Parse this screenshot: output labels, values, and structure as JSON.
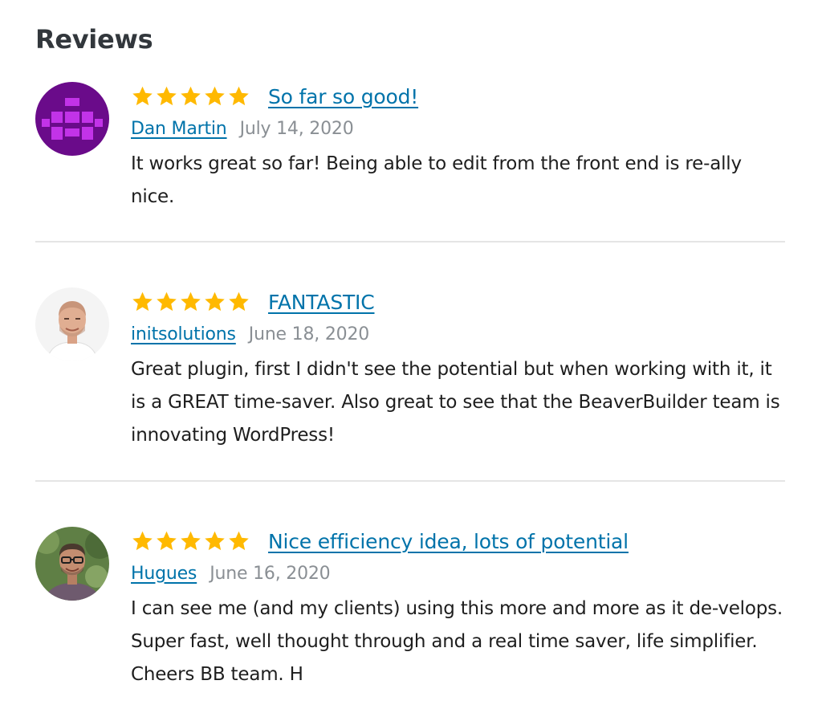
{
  "section": {
    "title": "Reviews"
  },
  "colors": {
    "link": "#0073aa",
    "star": "#ffb900",
    "date": "#8a8f94",
    "divider": "#e5e5e5"
  },
  "reviews": [
    {
      "rating": 5,
      "title": "So far so good!",
      "author": "Dan Martin",
      "date": "July 14, 2020",
      "body": "It works great so far! Being able to edit from the front end is re-ally nice.",
      "avatar": "identicon-avatar"
    },
    {
      "rating": 5,
      "title": "FANTASTIC",
      "author": "initsolutions",
      "date": "June 18, 2020",
      "body": "Great plugin, first I didn't see the potential but when working with it, it is a GREAT time-saver. Also great to see that the BeaverBuilder team is innovating WordPress!",
      "avatar": "photo-avatar"
    },
    {
      "rating": 5,
      "title": "Nice efficiency idea, lots of potential",
      "author": "Hugues",
      "date": "June 16, 2020",
      "body": "I can see me (and my clients) using this more and more as it de-velops. Super fast, well thought through and a real time saver, life simplifier. Cheers BB team. H",
      "avatar": "photo-avatar"
    }
  ]
}
